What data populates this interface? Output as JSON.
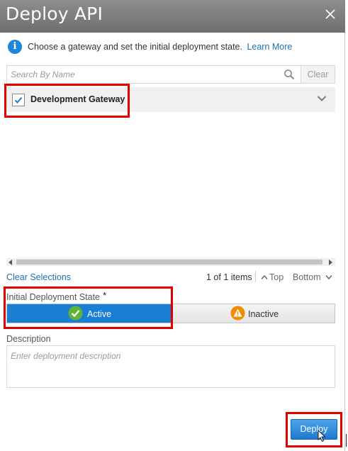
{
  "dialog": {
    "title": "Deploy API"
  },
  "info": {
    "text": "Choose a gateway and set the initial deployment state.",
    "link": "Learn More"
  },
  "search": {
    "placeholder": "Search By Name",
    "value": "",
    "clear_label": "Clear"
  },
  "gateways": [
    {
      "name": "Development Gateway",
      "checked": true
    }
  ],
  "pager": {
    "clear_selections": "Clear Selections",
    "count": "1 of 1 items",
    "top": "Top",
    "bottom": "Bottom"
  },
  "deployment_state": {
    "label": "Initial Deployment State",
    "required_marker": "*",
    "options": [
      {
        "label": "Active",
        "selected": true,
        "icon": "check-circle-icon"
      },
      {
        "label": "Inactive",
        "selected": false,
        "icon": "warning-icon"
      }
    ]
  },
  "description": {
    "label": "Description",
    "placeholder": "Enter deployment description",
    "value": ""
  },
  "actions": {
    "deploy": "Deploy"
  },
  "colors": {
    "header_bg": "#7b7b7b",
    "accent": "#1a7fd4",
    "link": "#1f6fb5",
    "highlight": "#e00000",
    "active_check": "#5fb336",
    "warning": "#f08c00"
  }
}
